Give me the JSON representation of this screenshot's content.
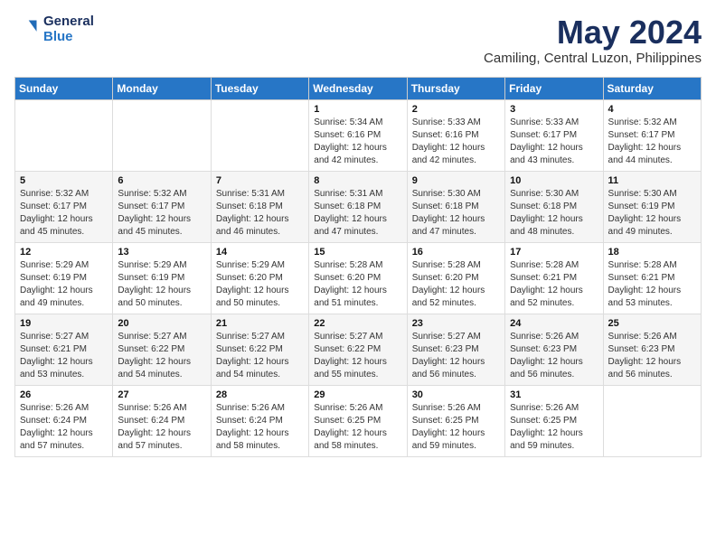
{
  "header": {
    "logo": {
      "general": "General",
      "blue": "Blue"
    },
    "title": "May 2024",
    "location": "Camiling, Central Luzon, Philippines"
  },
  "weekdays": [
    "Sunday",
    "Monday",
    "Tuesday",
    "Wednesday",
    "Thursday",
    "Friday",
    "Saturday"
  ],
  "weeks": [
    [
      {
        "day": "",
        "sunrise": "",
        "sunset": "",
        "daylight": ""
      },
      {
        "day": "",
        "sunrise": "",
        "sunset": "",
        "daylight": ""
      },
      {
        "day": "",
        "sunrise": "",
        "sunset": "",
        "daylight": ""
      },
      {
        "day": "1",
        "sunrise": "5:34 AM",
        "sunset": "6:16 PM",
        "daylight": "12 hours and 42 minutes."
      },
      {
        "day": "2",
        "sunrise": "5:33 AM",
        "sunset": "6:16 PM",
        "daylight": "12 hours and 42 minutes."
      },
      {
        "day": "3",
        "sunrise": "5:33 AM",
        "sunset": "6:17 PM",
        "daylight": "12 hours and 43 minutes."
      },
      {
        "day": "4",
        "sunrise": "5:32 AM",
        "sunset": "6:17 PM",
        "daylight": "12 hours and 44 minutes."
      }
    ],
    [
      {
        "day": "5",
        "sunrise": "5:32 AM",
        "sunset": "6:17 PM",
        "daylight": "12 hours and 45 minutes."
      },
      {
        "day": "6",
        "sunrise": "5:32 AM",
        "sunset": "6:17 PM",
        "daylight": "12 hours and 45 minutes."
      },
      {
        "day": "7",
        "sunrise": "5:31 AM",
        "sunset": "6:18 PM",
        "daylight": "12 hours and 46 minutes."
      },
      {
        "day": "8",
        "sunrise": "5:31 AM",
        "sunset": "6:18 PM",
        "daylight": "12 hours and 47 minutes."
      },
      {
        "day": "9",
        "sunrise": "5:30 AM",
        "sunset": "6:18 PM",
        "daylight": "12 hours and 47 minutes."
      },
      {
        "day": "10",
        "sunrise": "5:30 AM",
        "sunset": "6:18 PM",
        "daylight": "12 hours and 48 minutes."
      },
      {
        "day": "11",
        "sunrise": "5:30 AM",
        "sunset": "6:19 PM",
        "daylight": "12 hours and 49 minutes."
      }
    ],
    [
      {
        "day": "12",
        "sunrise": "5:29 AM",
        "sunset": "6:19 PM",
        "daylight": "12 hours and 49 minutes."
      },
      {
        "day": "13",
        "sunrise": "5:29 AM",
        "sunset": "6:19 PM",
        "daylight": "12 hours and 50 minutes."
      },
      {
        "day": "14",
        "sunrise": "5:29 AM",
        "sunset": "6:20 PM",
        "daylight": "12 hours and 50 minutes."
      },
      {
        "day": "15",
        "sunrise": "5:28 AM",
        "sunset": "6:20 PM",
        "daylight": "12 hours and 51 minutes."
      },
      {
        "day": "16",
        "sunrise": "5:28 AM",
        "sunset": "6:20 PM",
        "daylight": "12 hours and 52 minutes."
      },
      {
        "day": "17",
        "sunrise": "5:28 AM",
        "sunset": "6:21 PM",
        "daylight": "12 hours and 52 minutes."
      },
      {
        "day": "18",
        "sunrise": "5:28 AM",
        "sunset": "6:21 PM",
        "daylight": "12 hours and 53 minutes."
      }
    ],
    [
      {
        "day": "19",
        "sunrise": "5:27 AM",
        "sunset": "6:21 PM",
        "daylight": "12 hours and 53 minutes."
      },
      {
        "day": "20",
        "sunrise": "5:27 AM",
        "sunset": "6:22 PM",
        "daylight": "12 hours and 54 minutes."
      },
      {
        "day": "21",
        "sunrise": "5:27 AM",
        "sunset": "6:22 PM",
        "daylight": "12 hours and 54 minutes."
      },
      {
        "day": "22",
        "sunrise": "5:27 AM",
        "sunset": "6:22 PM",
        "daylight": "12 hours and 55 minutes."
      },
      {
        "day": "23",
        "sunrise": "5:27 AM",
        "sunset": "6:23 PM",
        "daylight": "12 hours and 56 minutes."
      },
      {
        "day": "24",
        "sunrise": "5:26 AM",
        "sunset": "6:23 PM",
        "daylight": "12 hours and 56 minutes."
      },
      {
        "day": "25",
        "sunrise": "5:26 AM",
        "sunset": "6:23 PM",
        "daylight": "12 hours and 56 minutes."
      }
    ],
    [
      {
        "day": "26",
        "sunrise": "5:26 AM",
        "sunset": "6:24 PM",
        "daylight": "12 hours and 57 minutes."
      },
      {
        "day": "27",
        "sunrise": "5:26 AM",
        "sunset": "6:24 PM",
        "daylight": "12 hours and 57 minutes."
      },
      {
        "day": "28",
        "sunrise": "5:26 AM",
        "sunset": "6:24 PM",
        "daylight": "12 hours and 58 minutes."
      },
      {
        "day": "29",
        "sunrise": "5:26 AM",
        "sunset": "6:25 PM",
        "daylight": "12 hours and 58 minutes."
      },
      {
        "day": "30",
        "sunrise": "5:26 AM",
        "sunset": "6:25 PM",
        "daylight": "12 hours and 59 minutes."
      },
      {
        "day": "31",
        "sunrise": "5:26 AM",
        "sunset": "6:25 PM",
        "daylight": "12 hours and 59 minutes."
      },
      {
        "day": "",
        "sunrise": "",
        "sunset": "",
        "daylight": ""
      }
    ]
  ]
}
